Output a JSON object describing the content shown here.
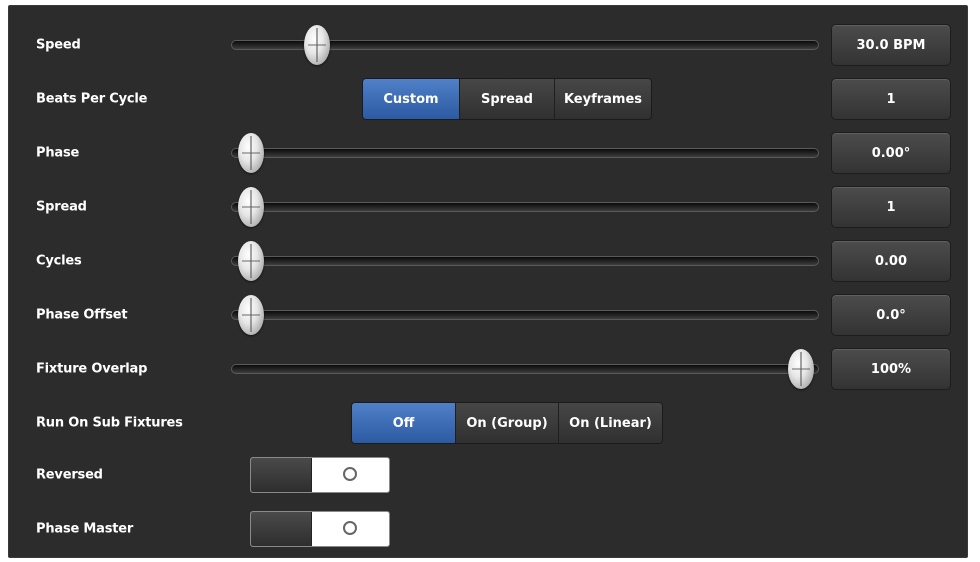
{
  "rows": {
    "speed": {
      "label": "Speed",
      "value": "30.0 BPM",
      "slider_fraction": 0.12
    },
    "beats": {
      "label": "Beats Per Cycle",
      "options": [
        "Custom",
        "Spread",
        "Keyframes"
      ],
      "selected": "Custom",
      "value": "1"
    },
    "phase": {
      "label": "Phase",
      "value": "0.00°",
      "slider_fraction": 0.0
    },
    "spread": {
      "label": "Spread",
      "value": "1",
      "slider_fraction": 0.0
    },
    "cycles": {
      "label": "Cycles",
      "value": "0.00",
      "slider_fraction": 0.0
    },
    "phase_offset": {
      "label": "Phase Offset",
      "value": "0.0°",
      "slider_fraction": 0.0
    },
    "overlap": {
      "label": "Fixture Overlap",
      "value": "100%",
      "slider_fraction": 1.0
    },
    "sub_fixtures": {
      "label": "Run On Sub Fixtures",
      "options": [
        "Off",
        "On (Group)",
        "On (Linear)"
      ],
      "selected": "Off"
    },
    "reversed": {
      "label": "Reversed",
      "state": "off"
    },
    "phase_master": {
      "label": "Phase Master",
      "state": "off"
    }
  },
  "colors": {
    "panel_bg": "#2c2c2c",
    "accent_selected": "#3a6bb8",
    "text": "#ffffff"
  }
}
